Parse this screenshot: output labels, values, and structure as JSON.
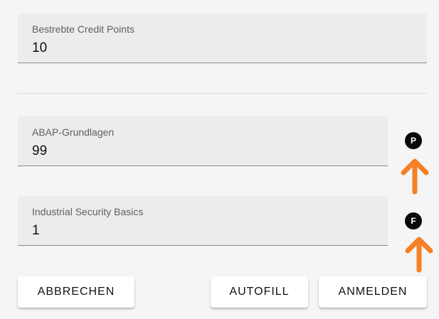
{
  "fields": {
    "credit_points": {
      "label": "Bestrebte Credit Points",
      "value": "10"
    },
    "abap": {
      "label": "ABAP-Grundlagen",
      "value": "99",
      "badge": "P"
    },
    "security": {
      "label": "Industrial Security Basics",
      "value": "1",
      "badge": "F"
    }
  },
  "annotation": {
    "arrow_color": "#f58025",
    "icon": "arrow-up-icon"
  },
  "buttons": {
    "cancel": "ABBRECHEN",
    "autofill": "AUTOFILL",
    "register": "ANMELDEN"
  }
}
